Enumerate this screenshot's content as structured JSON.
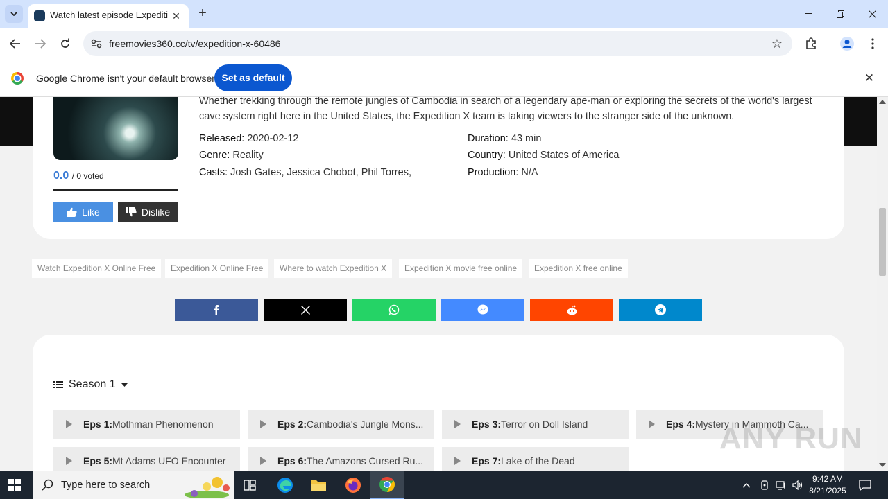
{
  "browser": {
    "tab_title": "Watch latest episode Expedition X",
    "url": "freemovies360.cc/tv/expedition-x-60486",
    "infobar_text": "Google Chrome isn't your default browser",
    "set_default_label": "Set as default"
  },
  "show": {
    "description": "Whether trekking through the remote jungles of Cambodia in search of a legendary ape-man or exploring the secrets of the world's largest cave system right here in the United States, the Expedition X team is taking viewers to the stranger side of the unknown.",
    "released_label": "Released:",
    "released": "2020-02-12",
    "genre_label": "Genre:",
    "genre": "Reality",
    "casts_label": "Casts:",
    "casts": "Josh Gates, Jessica Chobot, Phil Torres,",
    "duration_label": "Duration:",
    "duration": "43 min",
    "country_label": "Country:",
    "country": "United States of America",
    "production_label": "Production:",
    "production": "N/A",
    "rating_score": "0.0",
    "rating_votes": "/ 0 voted",
    "like_label": "Like",
    "dislike_label": "Dislike"
  },
  "tags": [
    "Watch Expedition X Online Free",
    "Expedition X Online Free",
    "Where to watch Expedition X",
    "Expedition X movie free online",
    "Expedition X free online"
  ],
  "share": [
    {
      "name": "facebook",
      "color": "#3b5998"
    },
    {
      "name": "x",
      "color": "#000000"
    },
    {
      "name": "whatsapp",
      "color": "#25d366"
    },
    {
      "name": "messenger",
      "color": "#448aff"
    },
    {
      "name": "reddit",
      "color": "#ff4500"
    },
    {
      "name": "telegram",
      "color": "#0088cc"
    }
  ],
  "season": {
    "label": "Season 1",
    "episodes": [
      {
        "label": "Eps 1:",
        "title": "Mothman Phenomenon"
      },
      {
        "label": "Eps 2:",
        "title": "Cambodia's Jungle Mons..."
      },
      {
        "label": "Eps 3:",
        "title": "Terror on Doll Island"
      },
      {
        "label": "Eps 4:",
        "title": "Mystery in Mammoth Ca..."
      },
      {
        "label": "Eps 5:",
        "title": "Mt Adams UFO Encounter"
      },
      {
        "label": "Eps 6:",
        "title": "The Amazons Cursed Ru..."
      },
      {
        "label": "Eps 7:",
        "title": "Lake of the Dead"
      }
    ]
  },
  "watermark": "ANY RUN",
  "taskbar": {
    "search_placeholder": "Type here to search",
    "time": "9:42 AM",
    "date": "8/21/2025"
  }
}
